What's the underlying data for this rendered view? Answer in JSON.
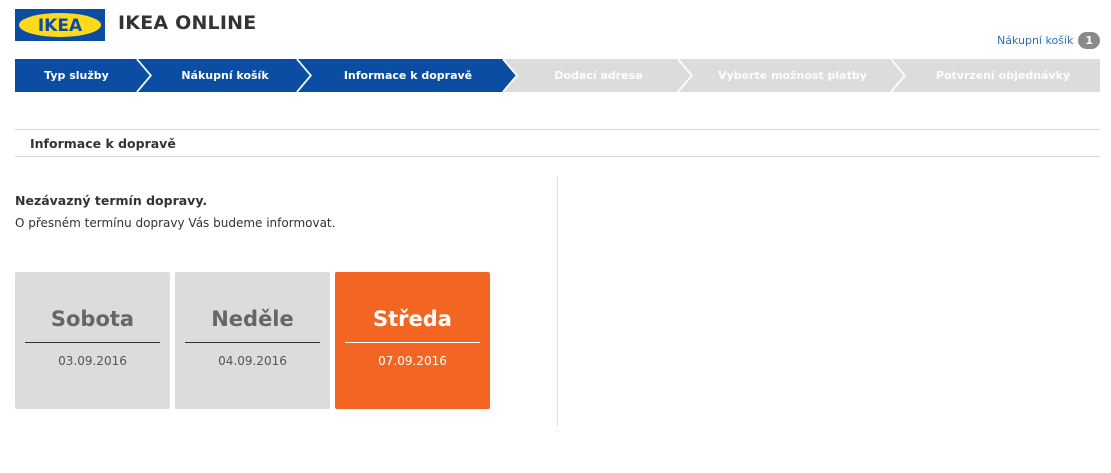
{
  "header": {
    "logo_text": "IKEA",
    "site_title": "IKEA ONLINE",
    "cart_label": "Nákupní košík",
    "cart_count": "1"
  },
  "colors": {
    "brand_blue": "#0a4da3",
    "brand_yellow": "#ffda1a",
    "step_done": "#0a4da3",
    "step_todo": "#dcdcdc",
    "selected_day": "#f26522"
  },
  "steps": [
    {
      "label": "Typ služby",
      "state": "done"
    },
    {
      "label": "Nákupní košík",
      "state": "done"
    },
    {
      "label": "Informace k dopravě",
      "state": "current"
    },
    {
      "label": "Dodací adresa",
      "state": "todo"
    },
    {
      "label": "Vyberte možnost platby",
      "state": "todo"
    },
    {
      "label": "Potvrzení objednávky",
      "state": "todo"
    }
  ],
  "section": {
    "title": "Informace k dopravě",
    "subheading": "Nezávazný termín dopravy.",
    "info": "O přesném termínu dopravy Vás budeme informovat."
  },
  "days": [
    {
      "name": "Sobota",
      "date": "03.09.2016",
      "selected": false
    },
    {
      "name": "Neděle",
      "date": "04.09.2016",
      "selected": false
    },
    {
      "name": "Středa",
      "date": "07.09.2016",
      "selected": true
    }
  ]
}
